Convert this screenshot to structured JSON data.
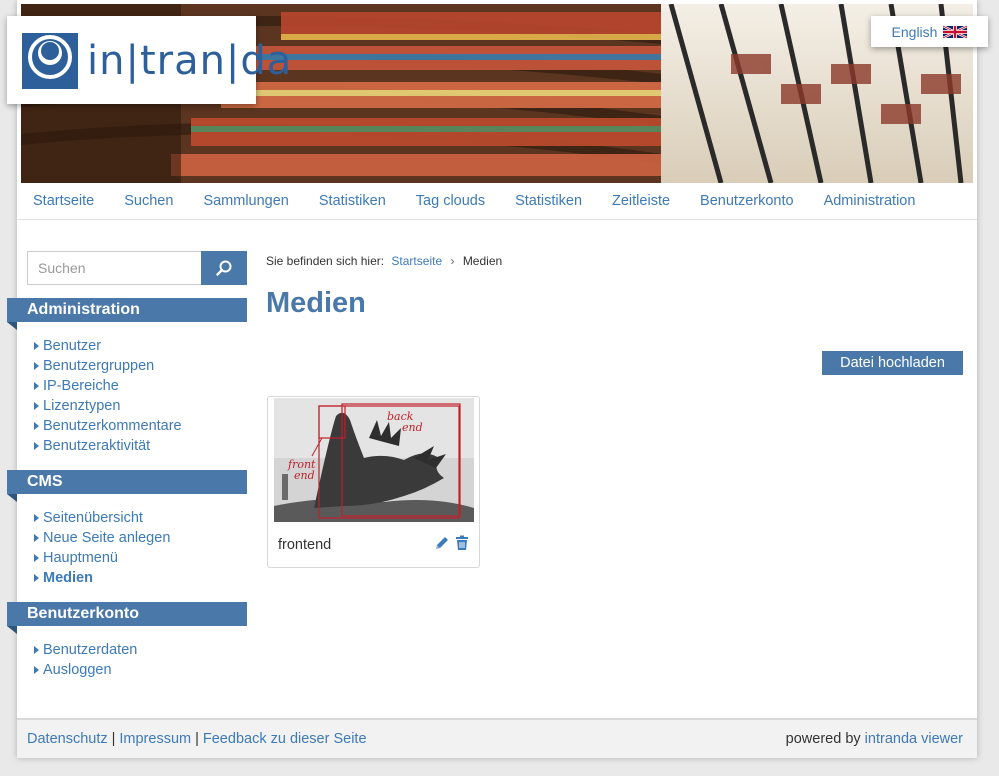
{
  "header": {
    "logo_text": "in|tran|da",
    "language_label": "English"
  },
  "nav": [
    {
      "label": "Startseite"
    },
    {
      "label": "Suchen"
    },
    {
      "label": "Sammlungen"
    },
    {
      "label": "Statistiken"
    },
    {
      "label": "Tag clouds"
    },
    {
      "label": "Statistiken"
    },
    {
      "label": "Zeitleiste"
    },
    {
      "label": "Benutzerkonto"
    },
    {
      "label": "Administration"
    }
  ],
  "search": {
    "placeholder": "Suchen",
    "value": ""
  },
  "sidebar": {
    "sections": [
      {
        "title": "Administration",
        "items": [
          {
            "label": "Benutzer"
          },
          {
            "label": "Benutzergruppen"
          },
          {
            "label": "IP-Bereiche"
          },
          {
            "label": "Lizenztypen"
          },
          {
            "label": "Benutzerkommentare"
          },
          {
            "label": "Benutzeraktivität"
          }
        ]
      },
      {
        "title": "CMS",
        "items": [
          {
            "label": "Seitenübersicht"
          },
          {
            "label": "Neue Seite anlegen"
          },
          {
            "label": "Hauptmenü"
          },
          {
            "label": "Medien",
            "active": true
          }
        ]
      },
      {
        "title": "Benutzerkonto",
        "items": [
          {
            "label": "Benutzerdaten"
          },
          {
            "label": "Ausloggen"
          }
        ]
      }
    ]
  },
  "breadcrumb": {
    "prefix": "Sie befinden sich hier:",
    "home": "Startseite",
    "separator": "›",
    "current": "Medien"
  },
  "main": {
    "title": "Medien",
    "upload_label": "Datei hochladen",
    "media": [
      {
        "name": "frontend",
        "thumb_labels": [
          "back",
          "end",
          "front",
          "end"
        ]
      }
    ]
  },
  "footer": {
    "links": [
      "Datenschutz",
      "Impressum",
      "Feedback zu dieser Seite"
    ],
    "separator": "|",
    "powered_prefix": "powered by",
    "powered_link": "intranda viewer"
  },
  "colors": {
    "accent": "#4a78a9",
    "link": "#3d7ab8",
    "background": "#e9e9e9"
  }
}
